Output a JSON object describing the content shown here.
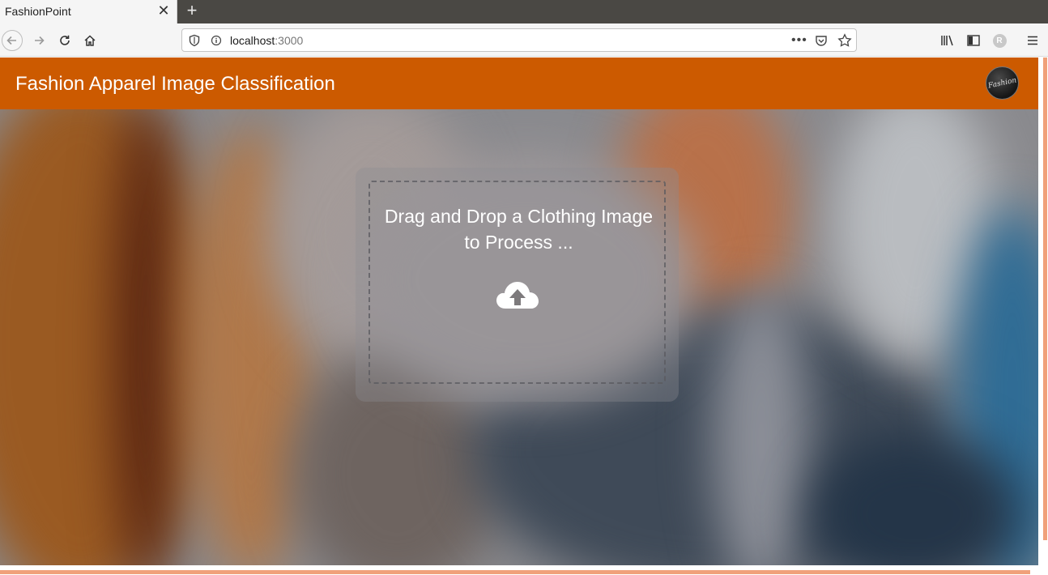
{
  "browser": {
    "tab_title": "FashionPoint",
    "tab_close": "✕",
    "new_tab": "+",
    "url_host": "localhost",
    "url_port": ":3000",
    "url_menu": "•••",
    "account_initial": "R"
  },
  "app": {
    "title": "Fashion Apparel Image Classification",
    "logo_text": "Fashion",
    "accent_color": "#cc5a00"
  },
  "dropzone": {
    "line1": "Drag and Drop a Clothing Image",
    "line2": "to Process ...",
    "icon": "cloud-upload-icon"
  }
}
